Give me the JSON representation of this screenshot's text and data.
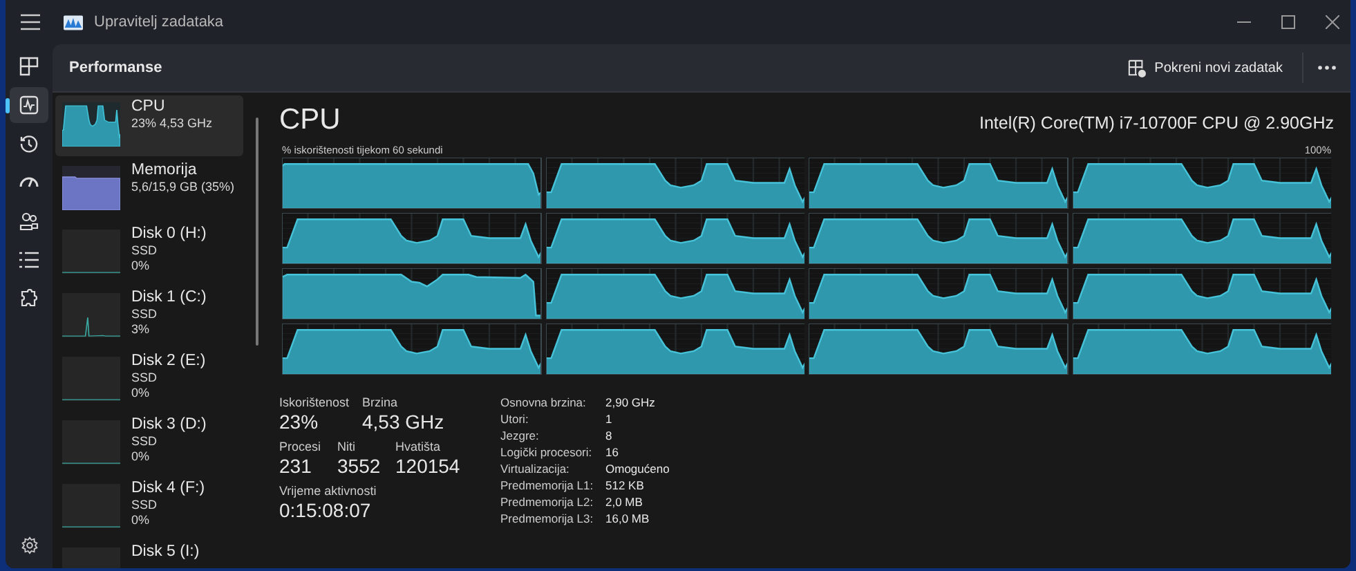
{
  "window": {
    "title": "Upravitelj zadataka"
  },
  "nav_items": [
    {
      "kind": "processes",
      "selected": false
    },
    {
      "kind": "performance",
      "selected": true
    },
    {
      "kind": "history",
      "selected": false
    },
    {
      "kind": "startup",
      "selected": false
    },
    {
      "kind": "users",
      "selected": false
    },
    {
      "kind": "details",
      "selected": false
    },
    {
      "kind": "services",
      "selected": false
    }
  ],
  "page_title": "Performanse",
  "run_task_button": "Pokreni novi zadatak",
  "resources": [
    {
      "kind": "cpu",
      "name": "CPU",
      "detail": "23% 4,53 GHz",
      "selected": true
    },
    {
      "kind": "memory",
      "name": "Memorija",
      "detail": "5,6/15,9 GB (35%)",
      "selected": false
    },
    {
      "kind": "disk",
      "name": "Disk 0 (H:)",
      "type": "SSD",
      "usage": "0%",
      "selected": false
    },
    {
      "kind": "disk",
      "name": "Disk 1 (C:)",
      "type": "SSD",
      "usage": "3%",
      "selected": false
    },
    {
      "kind": "disk",
      "name": "Disk 2 (E:)",
      "type": "SSD",
      "usage": "0%",
      "selected": false
    },
    {
      "kind": "disk",
      "name": "Disk 3 (D:)",
      "type": "SSD",
      "usage": "0%",
      "selected": false
    },
    {
      "kind": "disk",
      "name": "Disk 4 (F:)",
      "type": "SSD",
      "usage": "0%",
      "selected": false
    },
    {
      "kind": "disk",
      "name": "Disk 5 (I:)",
      "selected": false
    }
  ],
  "cpu": {
    "title": "CPU",
    "model": "Intel(R) Core(TM) i7-10700F CPU @ 2.90GHz",
    "graph_caption": "% iskorištenosti tijekom 60 sekundi",
    "graph_max": "100%",
    "stats_row_1": [
      {
        "label": "Iskorištenost",
        "value": "23%"
      },
      {
        "label": "Brzina",
        "value": "4,53 GHz"
      }
    ],
    "stats_row_2": [
      {
        "label": "Procesi",
        "value": "231"
      },
      {
        "label": "Niti",
        "value": "3552"
      },
      {
        "label": "Hvatišta",
        "value": "120154"
      }
    ],
    "uptime": {
      "label": "Vrijeme aktivnosti",
      "value": "0:15:08:07"
    },
    "specs": [
      {
        "label": "Osnovna brzina:",
        "value": "2,90 GHz"
      },
      {
        "label": "Utori:",
        "value": "1"
      },
      {
        "label": "Jezgre:",
        "value": "8"
      },
      {
        "label": "Logički procesori:",
        "value": "16"
      },
      {
        "label": "Virtualizacija:",
        "value": "Omogućeno"
      },
      {
        "label": "Predmemorija L1:",
        "value": "512 KB"
      },
      {
        "label": "Predmemorija L2:",
        "value": "2,0 MB"
      },
      {
        "label": "Predmemorija L3:",
        "value": "16,0 MB"
      }
    ]
  }
}
